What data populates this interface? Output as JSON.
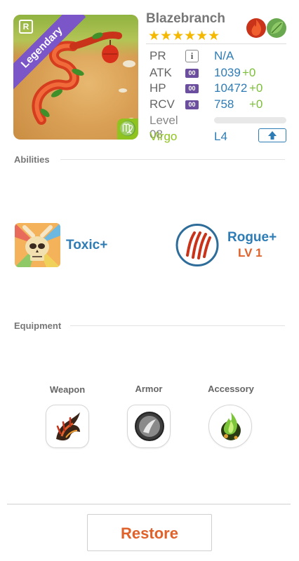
{
  "card": {
    "name": "Blazebranch",
    "rarity": "Legendary",
    "rarity_badge": "R",
    "zodiac_symbol": "♍",
    "stars": "★★★★★★",
    "elements": [
      "fire-element-icon",
      "leaf-element-icon"
    ],
    "colors": {
      "rarity": "#7b56c8",
      "value": "#2e7cb5",
      "bonus": "#7cbf3a",
      "accent": "#e0622a",
      "zodiac": "#8fc31f"
    }
  },
  "stats": {
    "pr": {
      "label": "PR",
      "chip": "i",
      "value": "N/A"
    },
    "atk": {
      "label": "ATK",
      "chip": "00",
      "value": "1039",
      "bonus": "+0"
    },
    "hp": {
      "label": "HP",
      "chip": "00",
      "value": "10472",
      "bonus": "+0"
    },
    "rcv": {
      "label": "RCV",
      "chip": "00",
      "value": "758",
      "bonus": "+0"
    },
    "level": {
      "label": "Level 08"
    },
    "sign": {
      "label": "Virgo",
      "value": "L4"
    }
  },
  "abilities": {
    "title": "Abilities",
    "items": [
      {
        "name": "Toxic+",
        "icon": "toxic-skull-icon"
      },
      {
        "name": "Rogue+",
        "level": "LV 1",
        "icon": "claw-marks-icon"
      }
    ]
  },
  "equipment": {
    "title": "Equipment",
    "slots": [
      {
        "label": "Weapon",
        "icon": "claw-weapon-icon"
      },
      {
        "label": "Armor",
        "icon": "shield-armor-icon"
      },
      {
        "label": "Accessory",
        "icon": "green-flame-accessory-icon"
      }
    ]
  },
  "footer": {
    "restore_label": "Restore"
  }
}
